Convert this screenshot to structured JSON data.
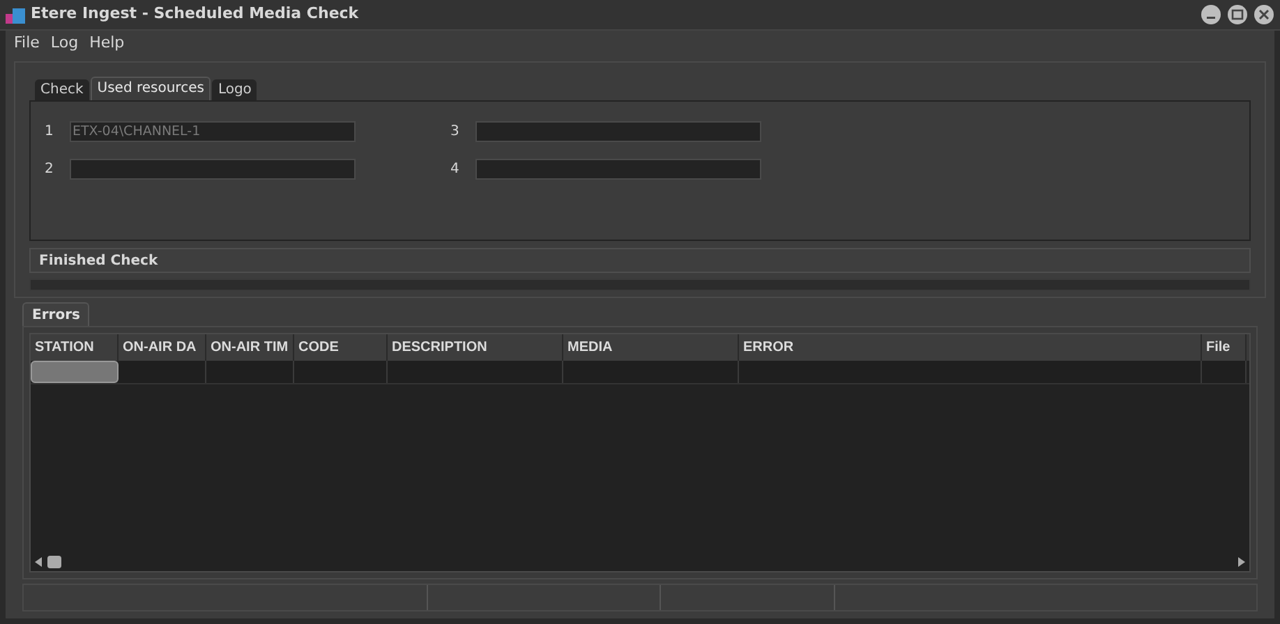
{
  "window": {
    "title": "Etere Ingest - Scheduled Media Check"
  },
  "menu": [
    "File",
    "Log",
    "Help"
  ],
  "tabs": [
    {
      "label": "Check",
      "selected": false
    },
    {
      "label": "Used resources",
      "selected": true
    },
    {
      "label": "Logo",
      "selected": false
    }
  ],
  "resources": [
    {
      "label": "1",
      "value": "ETX-04\\CHANNEL-1"
    },
    {
      "label": "2"
    },
    {
      "label": "3"
    },
    {
      "label": "4"
    }
  ],
  "status": {
    "text": "Finished Check"
  },
  "progress": {
    "level": 0
  },
  "lower_tabs": [
    {
      "label": "Errors",
      "selected": true
    }
  ],
  "table": {
    "columns": [
      "STATION",
      "ON-AIR DA",
      "ON-AIR TIM",
      "CODE",
      "DESCRIPTION",
      "MEDIA",
      "ERROR",
      "File"
    ],
    "rows": [
      {
        "selected": true
      }
    ]
  }
}
